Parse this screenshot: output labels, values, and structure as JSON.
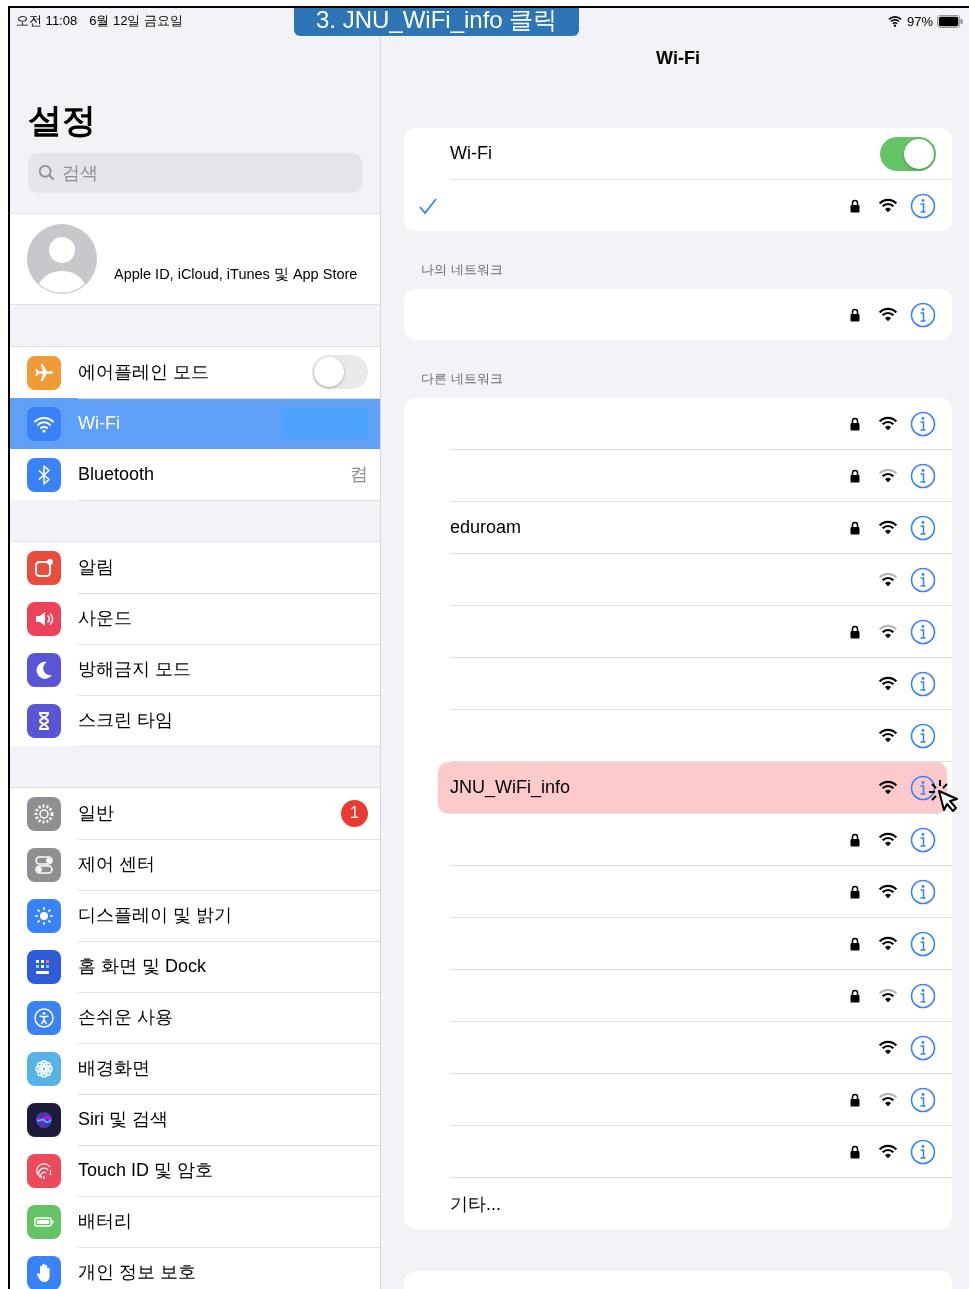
{
  "status_bar": {
    "time": "오전 11:08",
    "date": "6월 12일 금요일",
    "battery": "97%"
  },
  "banner": {
    "text": "3. JNU_WiFi_info 클릭"
  },
  "sidebar": {
    "title": "설정",
    "search": {
      "placeholder": "검색"
    },
    "profile": {
      "label": "Apple ID, iCloud, iTunes 및 App Store"
    },
    "groups": [
      {
        "items": [
          {
            "label": "에어플레인 모드",
            "kind": "toggle",
            "on": false,
            "selected": false,
            "color": "#f19a38"
          },
          {
            "label": "Wi-Fi",
            "kind": "redacted",
            "selected": true,
            "color": "#3a82f7"
          },
          {
            "label": "Bluetooth",
            "kind": "value",
            "value": "켬",
            "selected": false,
            "color": "#3a82f7"
          }
        ]
      },
      {
        "items": [
          {
            "label": "알림",
            "kind": "link",
            "selected": false,
            "color": "#eb4d3d"
          },
          {
            "label": "사운드",
            "kind": "link",
            "selected": false,
            "color": "#eb445a"
          },
          {
            "label": "방해금지 모드",
            "kind": "link",
            "selected": false,
            "color": "#5856d6"
          },
          {
            "label": "스크린 타임",
            "kind": "link",
            "selected": false,
            "color": "#5856d6"
          }
        ]
      },
      {
        "items": [
          {
            "label": "일반",
            "kind": "badge",
            "badge": "1",
            "selected": false,
            "color": "#8e8e93"
          },
          {
            "label": "제어 센터",
            "kind": "link",
            "selected": false,
            "color": "#8e8e93"
          },
          {
            "label": "디스플레이 및 밝기",
            "kind": "link",
            "selected": false,
            "color": "#3a82f7"
          },
          {
            "label": "홈 화면 및 Dock",
            "kind": "link",
            "selected": false,
            "color": "#2f5bd8"
          },
          {
            "label": "손쉬운 사용",
            "kind": "link",
            "selected": false,
            "color": "#3a82f7"
          },
          {
            "label": "배경화면",
            "kind": "link",
            "selected": false,
            "color": "#55b3e8"
          },
          {
            "label": "Siri 및 검색",
            "kind": "link",
            "selected": false,
            "color": "#1c1c3a"
          },
          {
            "label": "Touch ID 및 암호",
            "kind": "link",
            "selected": false,
            "color": "#ea4a5a"
          },
          {
            "label": "배터리",
            "kind": "link",
            "selected": false,
            "color": "#65c466"
          },
          {
            "label": "개인 정보 보호",
            "kind": "link",
            "selected": false,
            "color": "#3a82f7"
          }
        ]
      }
    ]
  },
  "detail": {
    "title": "Wi-Fi",
    "wifi_toggle": {
      "label": "Wi-Fi",
      "on": true
    },
    "connected": {
      "checked": true,
      "locked": true,
      "weak_signal": false
    },
    "my_networks": {
      "header": "나의 네트워크",
      "items": [
        {
          "locked": true,
          "weak_signal": false,
          "highlighted": false
        }
      ]
    },
    "other_networks": {
      "header": "다른 네트워크",
      "items": [
        {
          "locked": true,
          "weak_signal": false,
          "highlighted": false
        },
        {
          "locked": true,
          "weak_signal": true,
          "highlighted": false
        },
        {
          "name": "eduroam",
          "locked": true,
          "weak_signal": false,
          "highlighted": false
        },
        {
          "locked": false,
          "weak_signal": true,
          "highlighted": false
        },
        {
          "locked": true,
          "weak_signal": true,
          "highlighted": false
        },
        {
          "locked": false,
          "weak_signal": false,
          "highlighted": false
        },
        {
          "locked": false,
          "weak_signal": false,
          "highlighted": false
        },
        {
          "name": "JNU_WiFi_info",
          "locked": false,
          "weak_signal": false,
          "highlighted": true
        },
        {
          "locked": true,
          "weak_signal": false,
          "highlighted": false
        },
        {
          "locked": true,
          "weak_signal": false,
          "highlighted": false
        },
        {
          "locked": true,
          "weak_signal": false,
          "highlighted": false
        },
        {
          "locked": true,
          "weak_signal": true,
          "highlighted": false
        },
        {
          "locked": false,
          "weak_signal": false,
          "highlighted": false
        },
        {
          "locked": true,
          "weak_signal": true,
          "highlighted": false
        },
        {
          "locked": true,
          "weak_signal": false,
          "highlighted": false
        }
      ],
      "other": "기타..."
    }
  }
}
